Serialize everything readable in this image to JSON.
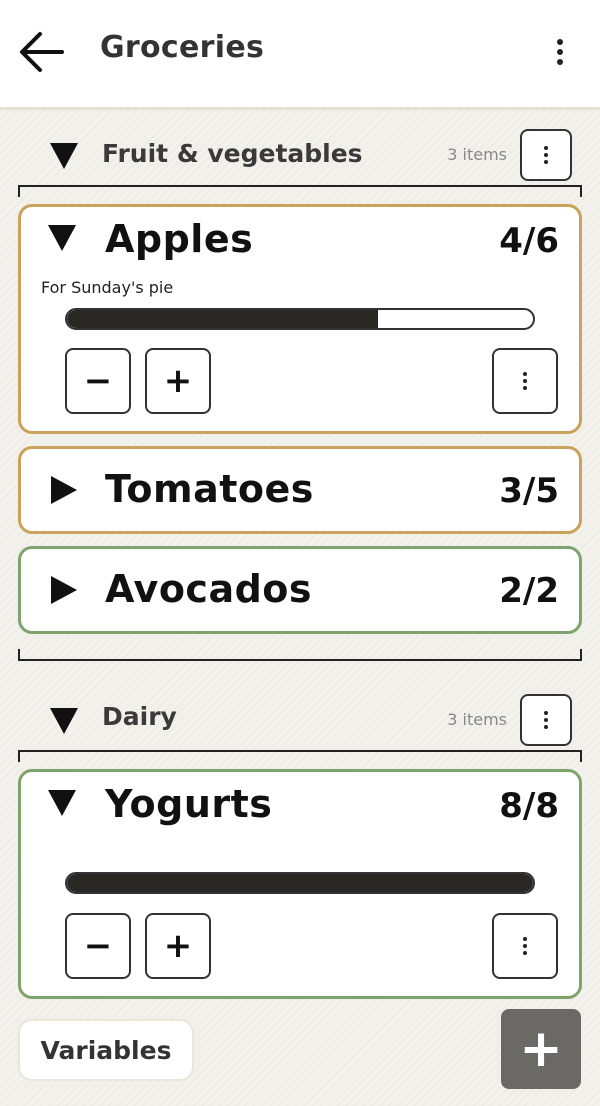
{
  "header": {
    "title": "Groceries",
    "back_icon": "arrow-left-icon",
    "menu_icon": "more-vertical-icon"
  },
  "sections": [
    {
      "title": "Fruit & vegetables",
      "count": "3 items",
      "expanded": true,
      "items": [
        {
          "name": "Apples",
          "qty": "4/6",
          "note": "For Sunday's pie",
          "expanded": true,
          "progress": 0.667,
          "border": "#c9a25b"
        },
        {
          "name": "Tomatoes",
          "qty": "3/5",
          "expanded": false,
          "border": "#c9a25b"
        },
        {
          "name": "Avocados",
          "qty": "2/2",
          "expanded": false,
          "border": "#7ea36c"
        }
      ]
    },
    {
      "title": "Dairy",
      "count": "3 items",
      "expanded": true,
      "items": [
        {
          "name": "Yogurts",
          "qty": "8/8",
          "expanded": true,
          "progress": 1.0,
          "border": "#7ea36c"
        }
      ]
    }
  ],
  "controls": {
    "decrement": "−",
    "increment": "+"
  },
  "footer": {
    "variables_label": "Variables",
    "fab_label": "+"
  },
  "colors": {
    "accent_partial": "#c9a25b",
    "accent_complete": "#7ea36c",
    "fab": "#6b6966",
    "progress_fill": "#2a2825"
  }
}
